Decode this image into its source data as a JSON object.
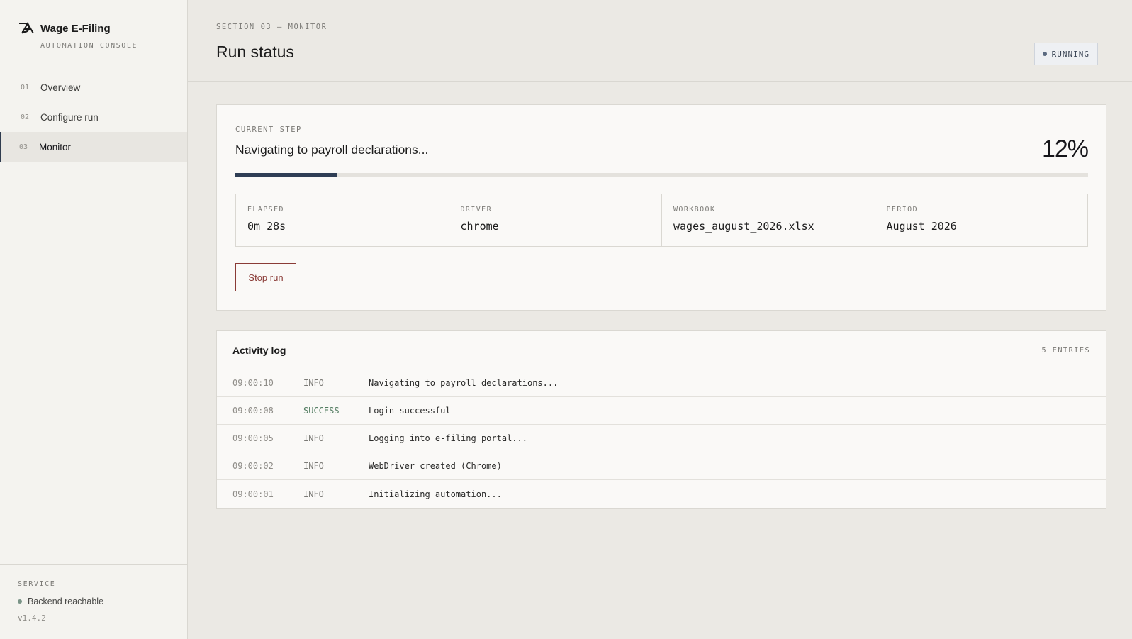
{
  "brand": {
    "title": "Wage E-Filing",
    "subtitle": "AUTOMATION CONSOLE"
  },
  "nav": [
    {
      "num": "01",
      "label": "Overview",
      "active": false
    },
    {
      "num": "02",
      "label": "Configure run",
      "active": false
    },
    {
      "num": "03",
      "label": "Monitor",
      "active": true
    }
  ],
  "service": {
    "label": "SERVICE",
    "status": "Backend reachable",
    "version": "v1.4.2"
  },
  "header": {
    "section": "SECTION 03 — MONITOR",
    "title": "Run status",
    "badge": "RUNNING"
  },
  "step": {
    "label": "CURRENT STEP",
    "text": "Navigating to payroll declarations...",
    "percent_label": "12%",
    "progress": 0.12
  },
  "meta": [
    {
      "label": "ELAPSED",
      "value": "0m 28s"
    },
    {
      "label": "DRIVER",
      "value": "chrome"
    },
    {
      "label": "WORKBOOK",
      "value": "wages_august_2026.xlsx"
    },
    {
      "label": "PERIOD",
      "value": "August 2026"
    }
  ],
  "stop_button": "Stop run",
  "log": {
    "title": "Activity log",
    "count": "5 ENTRIES",
    "entries": [
      {
        "time": "09:00:10",
        "level": "INFO",
        "message": "Navigating to payroll declarations..."
      },
      {
        "time": "09:00:08",
        "level": "SUCCESS",
        "message": "Login successful"
      },
      {
        "time": "09:00:05",
        "level": "INFO",
        "message": "Logging into e-filing portal..."
      },
      {
        "time": "09:00:02",
        "level": "INFO",
        "message": "WebDriver created (Chrome)"
      },
      {
        "time": "09:00:01",
        "level": "INFO",
        "message": "Initializing automation..."
      }
    ]
  },
  "colors": {
    "accent": "#2f3e55",
    "danger": "#8a3b36",
    "success": "#4f7a5e"
  }
}
